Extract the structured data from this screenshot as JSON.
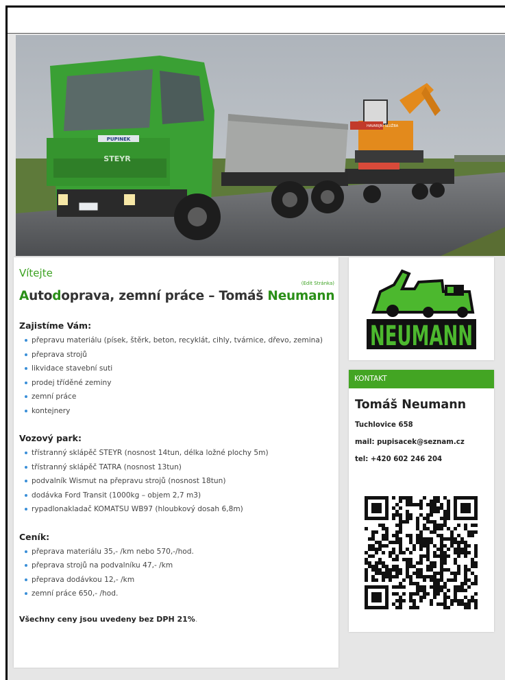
{
  "hero": {
    "truck_plate_label": "PUPINEK",
    "truck_brand": "STEYR",
    "trailer_sign": "HAVARIJNÍ SLUŽBA"
  },
  "main": {
    "welcome": "Vítejte",
    "edit_link": "(Edit Stránka)",
    "headline": {
      "part1_green": "A",
      "part2": "uto",
      "part3_green": "d",
      "part4": "oprava, zemní práce – Tomáš ",
      "part5_green": "Neumann"
    },
    "services_title": "Zajistíme Vám:",
    "services": [
      "přepravu materiálu (písek, štěrk, beton, recyklát, cihly, tvárnice, dřevo, zemina)",
      "přeprava strojů",
      "likvidace stavební suti",
      "prodej tříděné zeminy",
      "zemní práce",
      "kontejnery"
    ],
    "fleet_title": "Vozový park:",
    "fleet": [
      "třístranný sklápěč STEYR (nosnost 14tun, délka ložné plochy 5m)",
      "třístranný sklápěč TATRA (nosnost 13tun)",
      "podvalník Wismut na přepravu strojů (nosnost 18tun)",
      "dodávka Ford Transit (1000kg – objem 2,7 m3)",
      "rypadlonakladač KOMATSU WB97 (hloubkový dosah 6,8m)"
    ],
    "prices_title": "Ceník:",
    "prices": [
      "přeprava materiálu 35,- /km nebo 570,-/hod.",
      "přeprava strojů na podvalníku 47,- /km",
      "přeprava dodávkou 12,- /km",
      "zemní práce 650,- /hod."
    ],
    "vat_note": "Všechny ceny jsou uvedeny bez DPH 21%",
    "vat_note_tail": "."
  },
  "logo": {
    "text": "NEUMANN"
  },
  "contact": {
    "header": "KONTAKT",
    "name": "Tomáš Neumann",
    "address": "Tuchlovice 658",
    "email": "mail: pupisacek@seznam.cz",
    "phone": "tel: +420 602 246 204"
  },
  "colors": {
    "accent_green": "#43a523",
    "heading_green": "#2a8f17",
    "bullet_blue": "#3a8fd8",
    "truck_green": "#3aa034"
  }
}
